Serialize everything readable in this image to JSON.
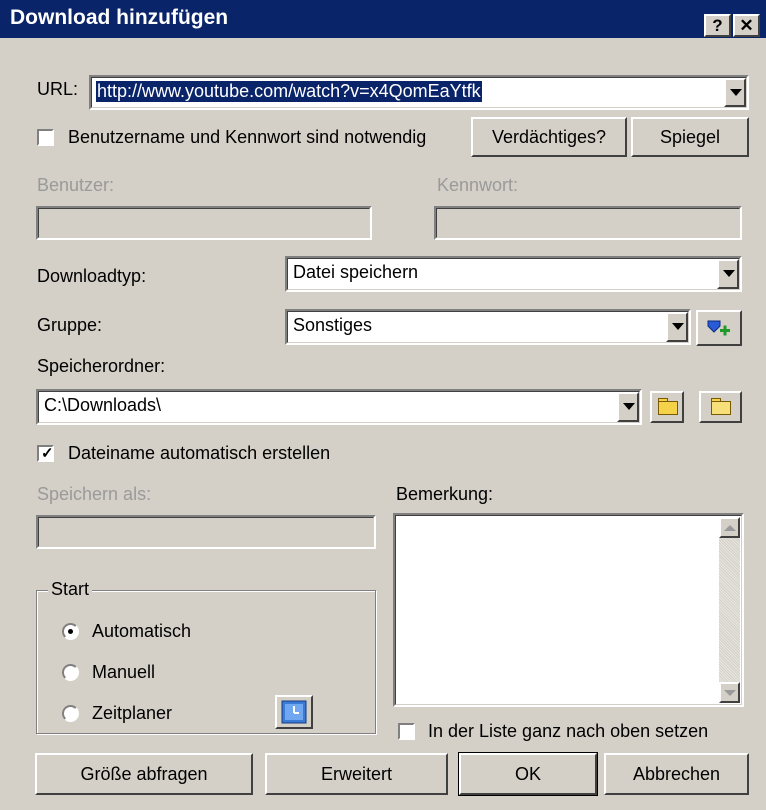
{
  "window": {
    "title": "Download hinzufügen",
    "help_button": "?",
    "close_button": "✕"
  },
  "url": {
    "label": "URL:",
    "value": "http://www.youtube.com/watch?v=x4QomEaYtfk"
  },
  "auth": {
    "checkbox_label": "Benutzername und Kennwort sind notwendig",
    "checked": false,
    "user_label": "Benutzer:",
    "password_label": "Kennwort:",
    "user_value": "",
    "password_value": ""
  },
  "buttons": {
    "suspicious": "Verdächtiges?",
    "mirror": "Spiegel",
    "query_size": "Größe abfragen",
    "advanced": "Erweitert",
    "ok": "OK",
    "cancel": "Abbrechen"
  },
  "download_type": {
    "label": "Downloadtyp:",
    "value": "Datei speichern"
  },
  "group": {
    "label": "Gruppe:",
    "value": "Sonstiges"
  },
  "save_folder": {
    "label": "Speicherordner:",
    "value": "C:\\Downloads\\"
  },
  "auto_filename": {
    "label": "Dateiname automatisch erstellen",
    "checked": true
  },
  "save_as": {
    "label": "Speichern als:",
    "value": ""
  },
  "remark": {
    "label": "Bemerkung:",
    "value": ""
  },
  "start": {
    "legend": "Start",
    "options": [
      "Automatisch",
      "Manuell",
      "Zeitplaner"
    ],
    "selected": "Automatisch"
  },
  "top_of_list": {
    "label": "In der Liste ganz nach oben setzen",
    "checked": false
  },
  "icons": {
    "add_group": "add-group-icon",
    "folder_browse": "folder-icon",
    "folder_open": "folder-open-icon",
    "scheduler": "calendar-icon"
  },
  "colors": {
    "titlebar": "#0a246a",
    "face": "#d4d0c8",
    "selection": "#0a246a"
  }
}
